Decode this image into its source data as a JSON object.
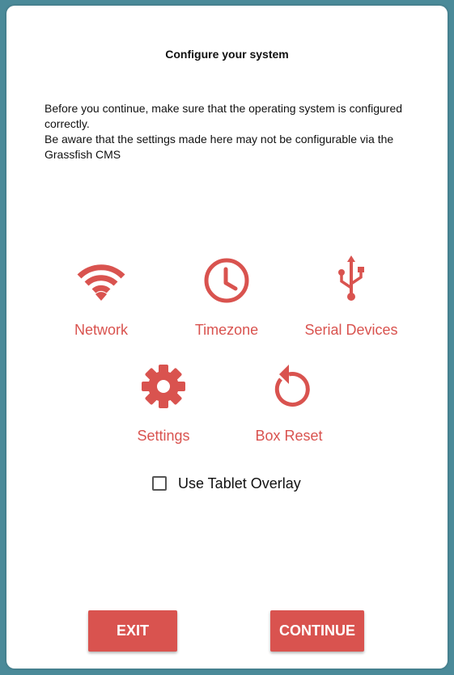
{
  "dialog": {
    "title": "Configure your system",
    "description_lines": [
      "Before you continue, make sure that the operating system is configured correctly.",
      "Be aware that the settings made here may not be configurable via the Grassfish CMS"
    ]
  },
  "tiles": {
    "network": {
      "label": "Network",
      "icon": "wifi-icon"
    },
    "timezone": {
      "label": "Timezone",
      "icon": "clock-icon"
    },
    "serial": {
      "label": "Serial Devices",
      "icon": "usb-icon"
    },
    "settings": {
      "label": "Settings",
      "icon": "gear-icon"
    },
    "reset": {
      "label": "Box Reset",
      "icon": "reset-icon"
    }
  },
  "overlay_option": {
    "label": "Use Tablet Overlay",
    "checked": false
  },
  "buttons": {
    "exit": "EXIT",
    "continue": "CONTINUE"
  },
  "colors": {
    "accent": "#d9534f",
    "background": "#4b8a99",
    "dialog": "#ffffff"
  }
}
